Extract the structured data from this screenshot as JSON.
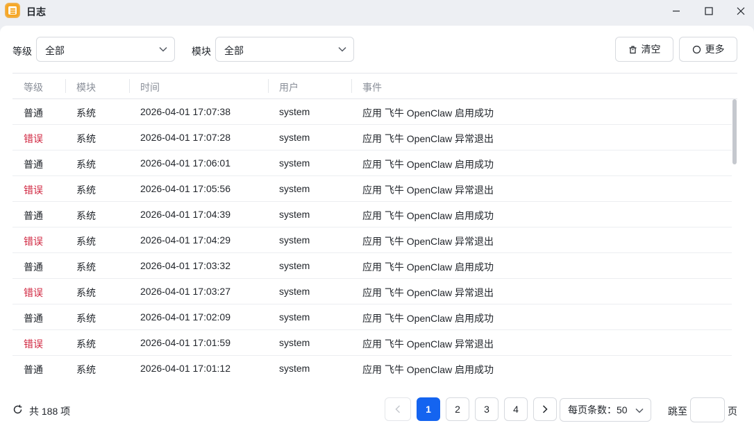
{
  "window": {
    "title": "日志"
  },
  "filters": {
    "level_label": "等级",
    "level_value": "全部",
    "module_label": "模块",
    "module_value": "全部"
  },
  "toolbar": {
    "clear_label": "清空",
    "more_label": "更多"
  },
  "table": {
    "columns": [
      "等级",
      "模块",
      "时间",
      "用户",
      "事件"
    ],
    "rows": [
      {
        "level": "普通",
        "level_type": "normal",
        "module": "系统",
        "time": "2026-04-01 17:07:38",
        "user": "system",
        "event": "应用 飞牛 OpenClaw 启用成功"
      },
      {
        "level": "错误",
        "level_type": "error",
        "module": "系统",
        "time": "2026-04-01 17:07:28",
        "user": "system",
        "event": "应用 飞牛 OpenClaw 异常退出"
      },
      {
        "level": "普通",
        "level_type": "normal",
        "module": "系统",
        "time": "2026-04-01 17:06:01",
        "user": "system",
        "event": "应用 飞牛 OpenClaw 启用成功"
      },
      {
        "level": "错误",
        "level_type": "error",
        "module": "系统",
        "time": "2026-04-01 17:05:56",
        "user": "system",
        "event": "应用 飞牛 OpenClaw 异常退出"
      },
      {
        "level": "普通",
        "level_type": "normal",
        "module": "系统",
        "time": "2026-04-01 17:04:39",
        "user": "system",
        "event": "应用 飞牛 OpenClaw 启用成功"
      },
      {
        "level": "错误",
        "level_type": "error",
        "module": "系统",
        "time": "2026-04-01 17:04:29",
        "user": "system",
        "event": "应用 飞牛 OpenClaw 异常退出"
      },
      {
        "level": "普通",
        "level_type": "normal",
        "module": "系统",
        "time": "2026-04-01 17:03:32",
        "user": "system",
        "event": "应用 飞牛 OpenClaw 启用成功"
      },
      {
        "level": "错误",
        "level_type": "error",
        "module": "系统",
        "time": "2026-04-01 17:03:27",
        "user": "system",
        "event": "应用 飞牛 OpenClaw 异常退出"
      },
      {
        "level": "普通",
        "level_type": "normal",
        "module": "系统",
        "time": "2026-04-01 17:02:09",
        "user": "system",
        "event": "应用 飞牛 OpenClaw 启用成功"
      },
      {
        "level": "错误",
        "level_type": "error",
        "module": "系统",
        "time": "2026-04-01 17:01:59",
        "user": "system",
        "event": "应用 飞牛 OpenClaw 异常退出"
      },
      {
        "level": "普通",
        "level_type": "normal",
        "module": "系统",
        "time": "2026-04-01 17:01:12",
        "user": "system",
        "event": "应用 飞牛 OpenClaw 启用成功"
      }
    ]
  },
  "pagination": {
    "total_text": "共 188 项",
    "pages": [
      "1",
      "2",
      "3",
      "4"
    ],
    "current_page": "1",
    "page_size_text": "每页条数：50",
    "jump_label": "跳至",
    "jump_suffix": "页",
    "jump_value": ""
  },
  "colors": {
    "accent": "#1464f0",
    "error": "#d0253f",
    "app_icon": "#f6a623"
  }
}
